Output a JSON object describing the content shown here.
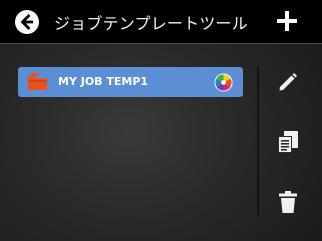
{
  "header": {
    "title": "ジョブテンプレートツール",
    "back_icon": "back-arrow-icon",
    "add_icon": "plus-icon"
  },
  "templates": [
    {
      "name": "MY JOB TEMP1",
      "icon": "folder-icon",
      "badge_icon": "color-wheel-icon",
      "selected": true
    }
  ],
  "actions": [
    {
      "name": "edit",
      "icon": "pencil-icon"
    },
    {
      "name": "copy",
      "icon": "copy-document-icon"
    },
    {
      "name": "delete",
      "icon": "trash-icon"
    }
  ],
  "colors": {
    "titlebar_bg": "#000000",
    "selection_bg": "#5b8ed4",
    "icon_fg": "#ffffff",
    "folder_orange": "#e8531c"
  }
}
